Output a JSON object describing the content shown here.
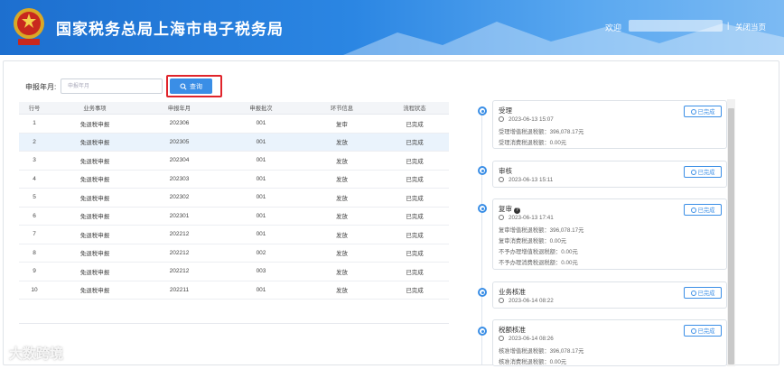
{
  "header": {
    "title": "国家税务总局上海市电子税务局",
    "welcome": "欢迎",
    "separator": "|",
    "close_label": "关闭当页"
  },
  "filter": {
    "label": "申报年月:",
    "placeholder": "申报年月",
    "query_label": "查询"
  },
  "table": {
    "columns": [
      "行号",
      "业务事项",
      "申报年月",
      "申报批次",
      "环节信息",
      "流程状态"
    ],
    "rows": [
      [
        "1",
        "免退税申报",
        "202306",
        "001",
        "复审",
        "已完成"
      ],
      [
        "2",
        "免退税申报",
        "202305",
        "001",
        "发放",
        "已完成"
      ],
      [
        "3",
        "免退税申报",
        "202304",
        "001",
        "发放",
        "已完成"
      ],
      [
        "4",
        "免退税申报",
        "202303",
        "001",
        "发放",
        "已完成"
      ],
      [
        "5",
        "免退税申报",
        "202302",
        "001",
        "发放",
        "已完成"
      ],
      [
        "6",
        "免退税申报",
        "202301",
        "001",
        "发放",
        "已完成"
      ],
      [
        "7",
        "免退税申报",
        "202212",
        "001",
        "发放",
        "已完成"
      ],
      [
        "8",
        "免退税申报",
        "202212",
        "002",
        "发放",
        "已完成"
      ],
      [
        "9",
        "免退税申报",
        "202212",
        "003",
        "发放",
        "已完成"
      ],
      [
        "10",
        "免退税申报",
        "202211",
        "001",
        "发放",
        "已完成"
      ]
    ]
  },
  "timeline": [
    {
      "title": "受理",
      "time": "2023-06-13 15:07",
      "status": "已完成",
      "details": [
        "受理增值税退税额：396,078.17元",
        "受理消费税退税额：0.00元"
      ]
    },
    {
      "title": "审核",
      "time": "2023-06-13 15:11",
      "status": "已完成",
      "details": []
    },
    {
      "title": "复审",
      "time": "2023-06-13 17:41",
      "status": "已完成",
      "details": [
        "复审增值税退税额：396,078.17元",
        "复审消费税退税额：0.00元",
        "不予办理增值税退税额：0.00元",
        "不予办理消费税退税额：0.00元"
      ]
    },
    {
      "title": "业务核准",
      "time": "2023-06-14 08:22",
      "status": "已完成",
      "details": []
    },
    {
      "title": "税额核准",
      "time": "2023-06-14 08:26",
      "status": "已完成",
      "details": [
        "核准增值税退税额：396,078.17元",
        "核准消费税退税额：0.00元"
      ]
    }
  ],
  "watermark": "大数跨境",
  "colors": {
    "primary": "#3a8ee6",
    "highlight": "#e0242b",
    "header_start": "#1d6fcf"
  }
}
